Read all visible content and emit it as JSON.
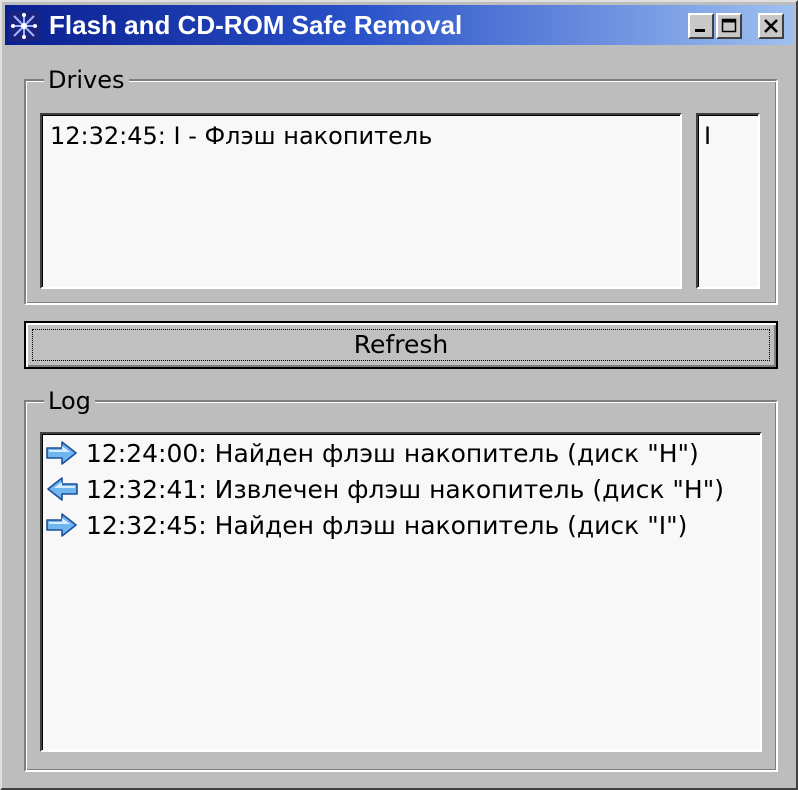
{
  "window": {
    "title": "Flash and CD-ROM Safe Removal",
    "icon": "snowflake-app-icon",
    "titlebar_gradient": [
      "#0a1f8f",
      "#2a52c9",
      "#9ec0f0"
    ],
    "controls": {
      "minimize": "minimize-icon",
      "maximize": "maximize-icon",
      "close": "close-icon"
    }
  },
  "drives": {
    "label": "Drives",
    "items": [
      {
        "text": "12:32:45: I - Флэш накопитель"
      }
    ],
    "letters": [
      {
        "text": "I"
      }
    ]
  },
  "refresh_button": {
    "label": "Refresh"
  },
  "log": {
    "label": "Log",
    "entries": [
      {
        "icon": "arrow-right-icon",
        "text": "12:24:00: Найден флэш накопитель (диск \"H\")"
      },
      {
        "icon": "arrow-left-icon",
        "text": "12:32:41: Извлечен флэш накопитель (диск \"H\")"
      },
      {
        "icon": "arrow-right-icon",
        "text": "12:32:45: Найден флэш накопитель (диск \"I\")"
      }
    ]
  }
}
